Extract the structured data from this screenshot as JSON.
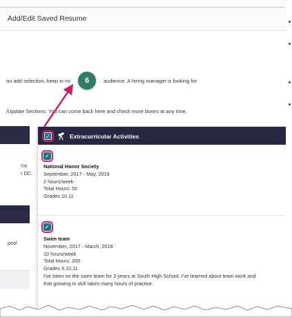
{
  "header": {
    "title": "Add/Edit Saved Resume"
  },
  "paragraphs": [
    "ou add selection, keep in mi",
    "audience. A hiring manager is looking for",
    "/Update Sections. You can come back here and check more boxes at any time."
  ],
  "annotation": {
    "step": "6"
  },
  "left_panel": {
    "text1a": "I'm",
    "text1b": "r DC",
    "text2": "pool"
  },
  "section": {
    "title": "Extracurricular Activities",
    "icon": "telescope-icon",
    "entries": [
      {
        "name": "National Honor Society",
        "dates": "September, 2017 - May, 2019",
        "hours": "2 hours/week",
        "total": "Total Hours: 50",
        "grades": "Grades 10,11"
      },
      {
        "name": "Swim team",
        "dates": "November, 2017 - March, 2018",
        "hours": "10 hours/week",
        "total": "Total Hours: 200",
        "grades": "Grades 9,10,11",
        "description_line1": "I've been on the swim team for 3 years at South High School. I've learned about team work and",
        "description_line2": "that growing in skill takes many hours of practice."
      }
    ]
  },
  "colors": {
    "header_bg": "#272744",
    "checkbox": "#1f6f8b",
    "highlight": "#c8226f",
    "badge": "#2e7d67"
  }
}
